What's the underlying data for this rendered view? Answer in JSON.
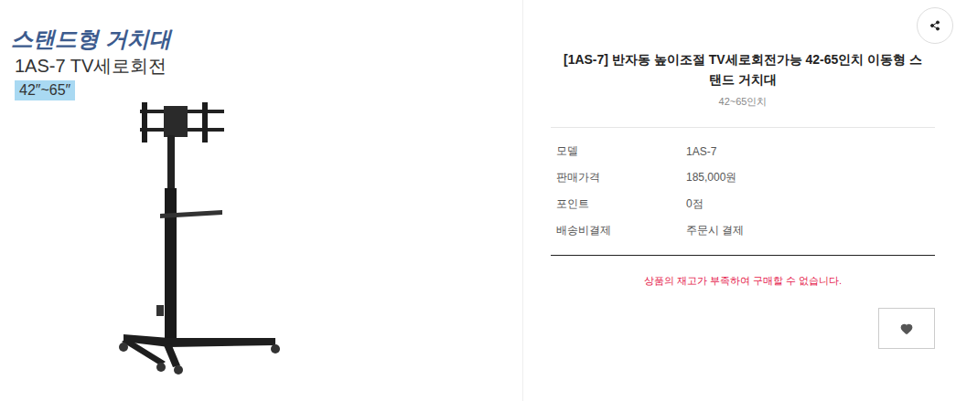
{
  "product_image": {
    "heading": "스탠드형 거치대",
    "model_line": "1AS-7 TV세로회전",
    "size_badge": "42″~65″"
  },
  "product": {
    "title": "[1AS-7] 반자동 높이조절 TV세로회전가능 42-65인치 이동형 스탠드 거치대",
    "subtitle": "42~65인치"
  },
  "details": [
    {
      "label": "모델",
      "value": "1AS-7"
    },
    {
      "label": "판매가격",
      "value": "185,000원"
    },
    {
      "label": "포인트",
      "value": "0점"
    },
    {
      "label": "배송비결제",
      "value": "주문시 결제"
    }
  ],
  "stock_message": "상품의 재고가 부족하여 구매할 수 없습니다."
}
